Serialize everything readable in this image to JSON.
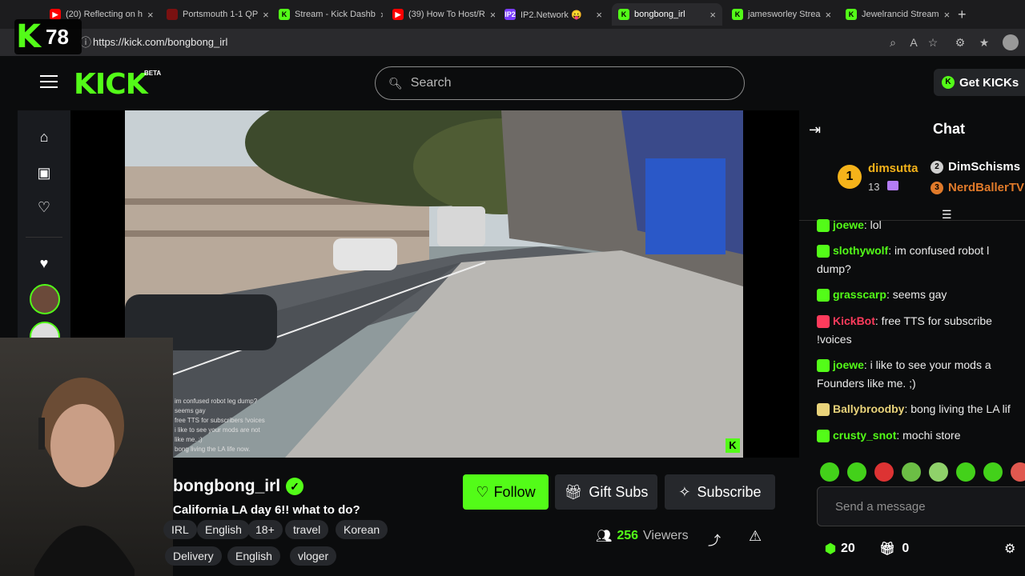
{
  "browser": {
    "tabs": [
      {
        "label": "(20) Reflecting on h",
        "fav": "▶",
        "fav_color": "#ff0000"
      },
      {
        "label": "Portsmouth 1-1 QP",
        "fav": "",
        "fav_color": "#7a1111"
      },
      {
        "label": "Stream - Kick Dashb",
        "fav": "K",
        "fav_color": "#53fc18"
      },
      {
        "label": "(39) How To Host/R",
        "fav": "▶",
        "fav_color": "#ff0000"
      },
      {
        "label": "IP2.Network 😛",
        "fav": "IP2",
        "fav_color": "#7a3cff"
      },
      {
        "label": "bongbong_irl",
        "fav": "K",
        "fav_color": "#53fc18"
      },
      {
        "label": "jamesworley Strea",
        "fav": "K",
        "fav_color": "#53fc18"
      },
      {
        "label": "Jewelrancid Stream",
        "fav": "K",
        "fav_color": "#53fc18"
      }
    ],
    "url": "https://kick.com/bongbong_irl"
  },
  "overlay": {
    "count": "78"
  },
  "header": {
    "logo": "KICK",
    "beta": "BETA",
    "search_placeholder": "Search",
    "get_kicks": "Get KICKs"
  },
  "video_overlay_chat": [
    "im confused robot leg dump?",
    "seems gay",
    "free TTS for subscribers !voices",
    "i like to see your mods are not",
    "like me. ;)",
    "bong living the LA life now."
  ],
  "stream": {
    "channel": "bongbong_irl",
    "title": "California LA day 6!! what to do?",
    "tags_row1": [
      "IRL",
      "English",
      "18+",
      "travel",
      "Korean"
    ],
    "tags_row2": [
      "Delivery",
      "English",
      "vloger"
    ],
    "follow": "Follow",
    "gift_subs": "Gift Subs",
    "subscribe": "Subscribe",
    "viewers_count": "256",
    "viewers_label": "Viewers"
  },
  "chat": {
    "title": "Chat",
    "pinned": {
      "top_rank": "1",
      "top_user": "dimsutta",
      "top_count": "13",
      "second_rank": "2",
      "second_user": "DimSchisms",
      "third_rank": "3",
      "third_user": "NerdBallerTV"
    },
    "messages": [
      {
        "user": "joewe",
        "color": "#53fc18",
        "text": " lol"
      },
      {
        "user": "slothywolf",
        "color": "#53fc18",
        "text": " im confused robot l"
      },
      {
        "user": "",
        "color": "#ffffff",
        "text": "dump?"
      },
      {
        "user": "grasscarp",
        "color": "#53fc18",
        "text": " seems gay"
      },
      {
        "user": "KickBot",
        "color": "#ff3b5c",
        "text": " free TTS for subscribe"
      },
      {
        "user": "",
        "color": "#ffffff",
        "text": "!voices"
      },
      {
        "user": "joewe",
        "color": "#53fc18",
        "text": " i like to see your mods a"
      },
      {
        "user": "",
        "color": "#ffffff",
        "text": "Founders like me. ;)"
      },
      {
        "user": "Ballybroodby",
        "color": "#e9d37a",
        "text": " bong living the LA lif"
      },
      {
        "user": "crusty_snot",
        "color": "#53fc18",
        "text": " mochi store"
      }
    ],
    "input_placeholder": "Send a message",
    "points": "20",
    "gifts": "0"
  }
}
